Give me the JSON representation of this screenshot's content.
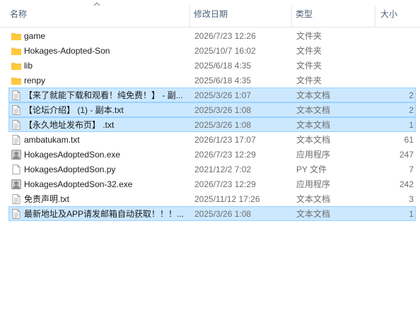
{
  "columns": {
    "name": "名称",
    "date": "修改日期",
    "type": "类型",
    "size": "大小"
  },
  "files": [
    {
      "name": "game",
      "date": "2026/7/23 12:26",
      "type": "文件夹",
      "size": "",
      "icon": "folder-icon",
      "selected": false
    },
    {
      "name": "Hokages-Adopted-Son",
      "date": "2025/10/7 16:02",
      "type": "文件夹",
      "size": "",
      "icon": "folder-icon",
      "selected": false
    },
    {
      "name": "lib",
      "date": "2025/6/18 4:35",
      "type": "文件夹",
      "size": "",
      "icon": "folder-icon",
      "selected": false
    },
    {
      "name": "renpy",
      "date": "2025/6/18 4:35",
      "type": "文件夹",
      "size": "",
      "icon": "folder-icon",
      "selected": false
    },
    {
      "name": "【来了就能下载和观看！纯免费！】 - 副...",
      "date": "2025/3/26 1:07",
      "type": "文本文档",
      "size": "2",
      "icon": "text-file-icon",
      "selected": true
    },
    {
      "name": "【论坛介绍】 (1) - 副本.txt",
      "date": "2025/3/26 1:08",
      "type": "文本文档",
      "size": "2",
      "icon": "text-file-icon",
      "selected": true
    },
    {
      "name": "【永久地址发布页】 .txt",
      "date": "2025/3/26 1:08",
      "type": "文本文档",
      "size": "1",
      "icon": "text-file-icon",
      "selected": true
    },
    {
      "name": "ambatukam.txt",
      "date": "2026/1/23 17:07",
      "type": "文本文档",
      "size": "61",
      "icon": "text-file-icon",
      "selected": false
    },
    {
      "name": "HokagesAdoptedSon.exe",
      "date": "2026/7/23 12:29",
      "type": "应用程序",
      "size": "247",
      "icon": "app-icon",
      "selected": false
    },
    {
      "name": "HokagesAdoptedSon.py",
      "date": "2021/12/2 7:02",
      "type": "PY 文件",
      "size": "7",
      "icon": "blank-file-icon",
      "selected": false
    },
    {
      "name": "HokagesAdoptedSon-32.exe",
      "date": "2026/7/23 12:29",
      "type": "应用程序",
      "size": "242",
      "icon": "app-icon",
      "selected": false
    },
    {
      "name": "免责声明.txt",
      "date": "2025/11/12 17:26",
      "type": "文本文档",
      "size": "3",
      "icon": "text-file-icon",
      "selected": false
    },
    {
      "name": "最新地址及APP请发邮箱自动获取！！！...",
      "date": "2025/3/26 1:08",
      "type": "文本文档",
      "size": "1",
      "icon": "text-file-icon",
      "selected": true
    }
  ]
}
